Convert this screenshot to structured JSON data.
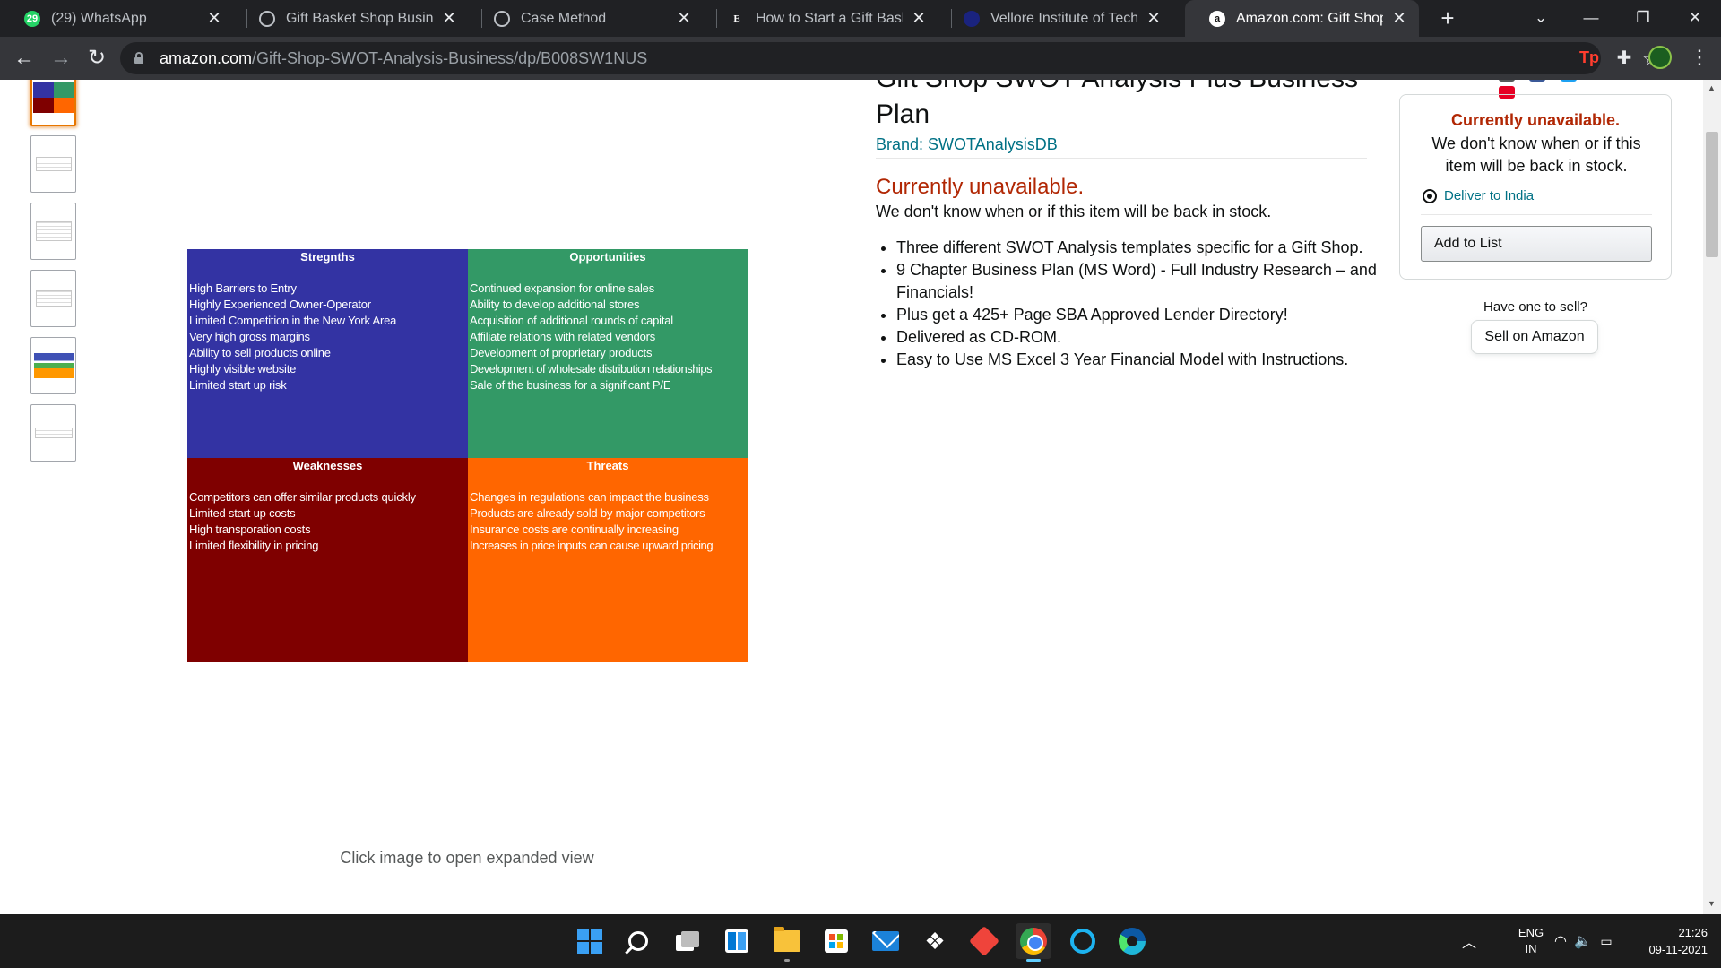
{
  "browser": {
    "tabs": [
      {
        "title": "(29) WhatsApp",
        "favicon": "whatsapp-icon",
        "badge": "29",
        "active": false
      },
      {
        "title": "Gift Basket Shop Business Plan",
        "favicon": "globe-icon",
        "active": false
      },
      {
        "title": "Case Method",
        "favicon": "globe-icon",
        "active": false
      },
      {
        "title": "How to Start a Gift Basket Sh",
        "favicon": "e-letter-icon",
        "letter": "E",
        "active": false
      },
      {
        "title": "Vellore Institute of Technology",
        "favicon": "vit-icon",
        "active": false
      },
      {
        "title": "Amazon.com: Gift Shop SWOT",
        "favicon": "amazon-icon",
        "letter": "a",
        "active": true
      }
    ],
    "url_host": "amazon.com",
    "url_path": "/Gift-Shop-SWOT-Analysis-Business/dp/B008SW1NUS",
    "ext_tp_label": "Tp"
  },
  "product": {
    "title": "Gift Shop SWOT Analysis Plus Business Plan",
    "brand": "Brand: SWOTAnalysisDB",
    "availability": "Currently unavailable.",
    "availability_note": "We don't know when or if this item will be back in stock.",
    "bullets": [
      "Three different SWOT Analysis templates specific for a Gift Shop.",
      "9 Chapter Business Plan (MS Word) - Full Industry Research – and Financials!",
      "Plus get a 425+ Page SBA Approved Lender Directory!",
      "Delivered as CD-ROM.",
      "Easy to Use MS Excel 3 Year Financial Model with Instructions."
    ],
    "image_hint": "Click image to open expanded view",
    "thumbnail_count": 6
  },
  "swot": {
    "strengths": {
      "title": "Stregnths",
      "color": "#3333a3",
      "items": [
        "High Barriers to Entry",
        "Highly Experienced Owner-Operator",
        "Limited Competition in the New York Area",
        "Very high gross margins",
        "Ability to sell products online",
        "Highly visible website",
        "Limited start up risk"
      ]
    },
    "opportunities": {
      "title": "Opportunities",
      "color": "#339966",
      "items": [
        "Continued expansion for online sales",
        "Ability to develop additional stores",
        "Acquisition of additional rounds of capital",
        "Affiliate relations with related vendors",
        "Development of proprietary products",
        "Development of wholesale distribution relationships",
        "Sale of the business for a significant P/E"
      ]
    },
    "weaknesses": {
      "title": "Weaknesses",
      "color": "#7f0000",
      "items": [
        "Competitors can offer similar products quickly",
        "Limited start up costs",
        "High transporation costs",
        "Limited flexibility in pricing"
      ]
    },
    "threats": {
      "title": "Threats",
      "color": "#ff6600",
      "items": [
        "Changes in regulations can impact the business",
        "Products are already sold by major competitors",
        "Insurance costs are continually increasing",
        "Increases in price inputs can cause upward pricing"
      ]
    }
  },
  "buybox": {
    "unavailable": "Currently unavailable.",
    "note": "We don't know when or if this item will be back in stock.",
    "deliver": "Deliver to India",
    "add_to_list": "Add to List",
    "have_one": "Have one to sell?",
    "sell_button": "Sell on Amazon"
  },
  "taskbar": {
    "lang_top": "ENG",
    "lang_bottom": "IN",
    "time": "21:26",
    "date": "09-11-2021"
  },
  "colors": {
    "accent_link": "#007185",
    "unavailable_red": "#b12704",
    "chrome_dark": "#202124"
  }
}
